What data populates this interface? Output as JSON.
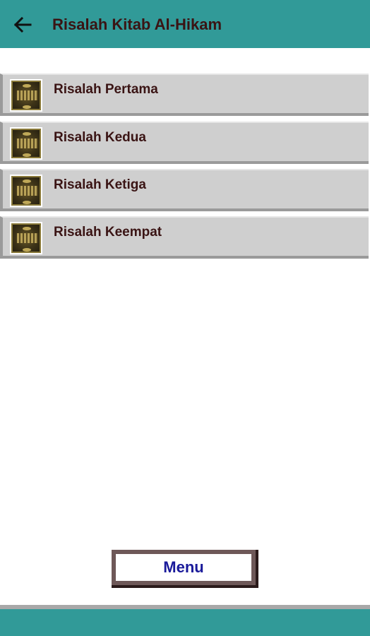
{
  "app_bar": {
    "title": "Risalah Kitab Al-Hikam",
    "back_icon": "arrow-left-icon",
    "color": "#319a98"
  },
  "list": {
    "items": [
      {
        "label": "Risalah Pertama",
        "icon": "kitab-cover-icon"
      },
      {
        "label": "Risalah Kedua",
        "icon": "kitab-cover-icon"
      },
      {
        "label": "Risalah Ketiga",
        "icon": "kitab-cover-icon"
      },
      {
        "label": "Risalah Keempat",
        "icon": "kitab-cover-icon"
      }
    ],
    "item_color": "#cfcfcf"
  },
  "footer": {
    "menu_label": "Menu",
    "menu_text_color": "#1a1a9a"
  }
}
